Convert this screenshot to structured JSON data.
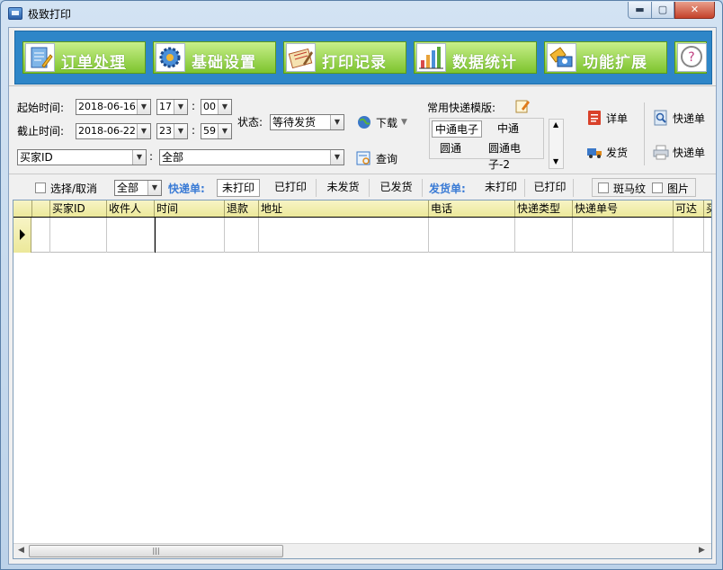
{
  "window": {
    "title": "极致打印",
    "min": "▬",
    "max": "▢",
    "close": "✕"
  },
  "nav": {
    "items": [
      {
        "label": "订单处理",
        "icon": "clipboard-pencil-icon"
      },
      {
        "label": "基础设置",
        "icon": "gear-icon"
      },
      {
        "label": "打印记录",
        "icon": "notepad-icon"
      },
      {
        "label": "数据统计",
        "icon": "bar-chart-icon"
      },
      {
        "label": "功能扩展",
        "icon": "puzzle-tools-icon"
      },
      {
        "label": "",
        "icon": "help-icon"
      }
    ]
  },
  "controls": {
    "start_label": "起始时间:",
    "start_date": "2018-06-16",
    "start_hour": "17",
    "start_min": "00",
    "end_label": "截止时间:",
    "end_date": "2018-06-22",
    "end_hour": "23",
    "end_min": "59",
    "colon": ":",
    "status_label": "状态:",
    "status_value": "等待发货",
    "download_label": "下载",
    "query_label": "查询",
    "buyer_field": "买家ID",
    "buyer_value": "全部",
    "template_label": "常用快递模版:",
    "templates": [
      "中通电子",
      "中通",
      "圆通",
      "圆通电子-2"
    ],
    "detail_label": "详单",
    "ship_label": "发货",
    "express_label_1": "快递单",
    "express_label_2": "快递单"
  },
  "filter": {
    "select_label": "选择/取消",
    "scope_value": "全部",
    "express_group": "快递单:",
    "express_tabs": [
      "未打印",
      "已打印",
      "未发货",
      "已发货"
    ],
    "ship_group": "发货单:",
    "ship_tabs": [
      "未打印",
      "已打印"
    ],
    "zebra_label": "斑马纹",
    "image_label": "图片"
  },
  "grid": {
    "columns": [
      "买家ID",
      "收件人",
      "时间",
      "退款",
      "地址",
      "电话",
      "快递类型",
      "快递单号",
      "可达",
      "买"
    ]
  },
  "colors": {
    "nav_bg": "#2e86c8",
    "nav_btn": "#8fd03c",
    "header_bg": "#ece89a",
    "group_label": "#3a7bd5"
  }
}
